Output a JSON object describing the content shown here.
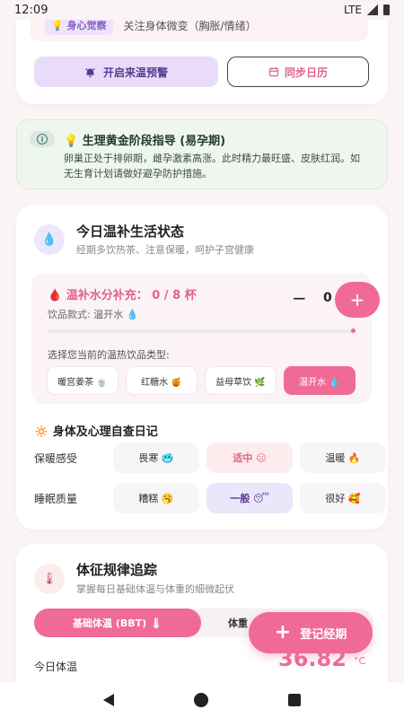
{
  "status_bar": {
    "time": "12:09",
    "network": "LTE"
  },
  "top_card": {
    "awareness_tag": "💡 身心觉察",
    "awareness_text": "关注身体微变（胸胀/情绪）",
    "warn_button": "开启来温预警",
    "sync_button": "同步日历"
  },
  "guide": {
    "title": "💡 生理黄金阶段指导 (易孕期)",
    "body": "卵巢正处于排卵期，雌孕激素高涨。此时精力最旺盛、皮肤红润。如无生育计划请做好避孕防护措施。"
  },
  "warm": {
    "title": "今日温补生活状态",
    "subtitle": "经期多饮热茶、注意保暖，呵护子宫健康",
    "water_title": "🩸 温补水分补充： 0 / 8 杯",
    "water_style": "饮品款式: 温开水 💧",
    "count": "0",
    "minus": "−",
    "plus": "+",
    "progress": 0.0,
    "choose_label": "选择您当前的温热饮品类型:",
    "drinks": [
      "暖宫姜茶 🍵",
      "红糖水 🍯",
      "益母草饮 🌿",
      "温开水 💧"
    ],
    "selected_drink": 3
  },
  "diary": {
    "title": "🔅 身体及心理自查日记",
    "rows": [
      {
        "label": "保暖感受",
        "options": [
          "畏寒 🥶",
          "适中 😐",
          "温暖 🔥"
        ],
        "selected": 1
      },
      {
        "label": "睡眠质量",
        "options": [
          "糟糕 🥱",
          "一般 😴",
          "很好 🥰"
        ],
        "selected": 1
      }
    ]
  },
  "tracker": {
    "title": "体征规律追踪",
    "subtitle": "掌握每日基础体温与体重的细微起伏",
    "tab_bbt": "基础体温 (BBT) 🌡",
    "tab_weight": "体重",
    "today_label": "今日体温",
    "today_value": "36.82",
    "today_unit": "°C"
  },
  "fab": {
    "label": "登记经期"
  }
}
